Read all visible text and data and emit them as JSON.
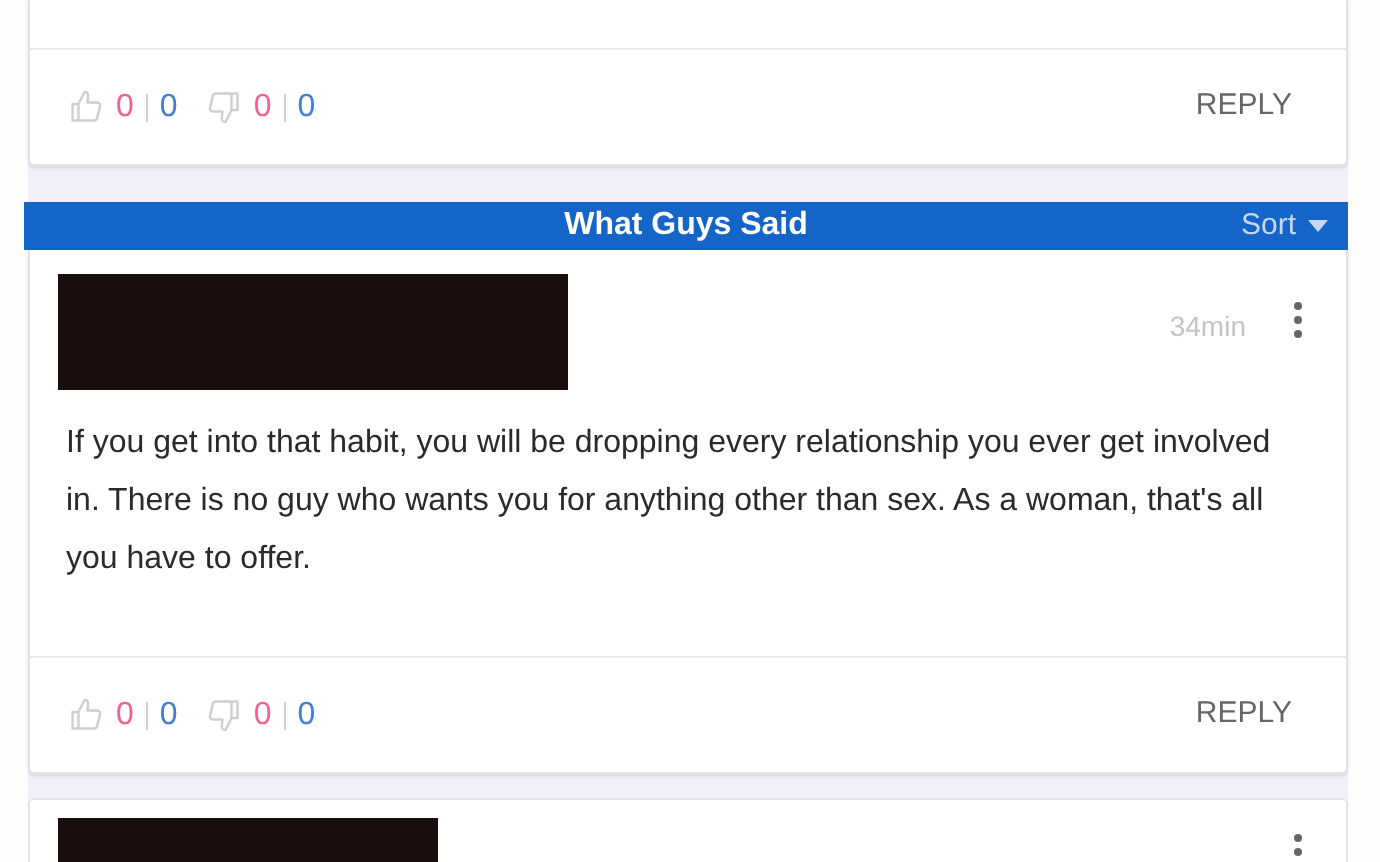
{
  "top_comment": {
    "votes": [
      {
        "kind": "like",
        "female_count": "0",
        "male_count": "0"
      },
      {
        "kind": "dislike",
        "female_count": "0",
        "male_count": "0"
      }
    ],
    "reply": "REPLY"
  },
  "section": {
    "title": "What Guys Said",
    "sort": "Sort"
  },
  "comment": {
    "time": "34min",
    "body": "If you get into that habit, you will be dropping every relationship you ever get involved in. There is no guy who wants you for anything other than sex. As a woman, that's all you have to offer.",
    "votes": [
      {
        "kind": "like",
        "female_count": "0",
        "male_count": "0"
      },
      {
        "kind": "dislike",
        "female_count": "0",
        "male_count": "0"
      }
    ],
    "reply": "REPLY"
  }
}
